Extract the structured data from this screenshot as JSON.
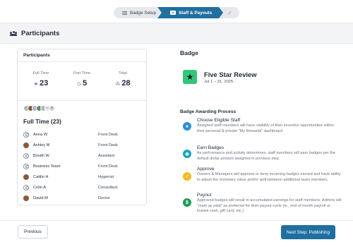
{
  "stepper": {
    "steps": [
      {
        "label": "Badge Setup",
        "state": "inactive"
      },
      {
        "label": "Staff & Payouts",
        "state": "active"
      },
      {
        "label": "✓",
        "state": "done"
      }
    ]
  },
  "header": {
    "title": "Participants"
  },
  "participants_panel": {
    "title": "Participants",
    "stats": [
      {
        "label": "Full Time",
        "value": "23"
      },
      {
        "label": "Part Time",
        "value": "5"
      },
      {
        "label": "Total",
        "value": "28"
      }
    ],
    "more_avatars": "+22",
    "group_title": "Full Time (23)",
    "staff": [
      {
        "name": "Anna W",
        "role": "Front Desk",
        "avatar": "generic"
      },
      {
        "name": "Ashley M",
        "role": "Front Desk",
        "avatar": "photo"
      },
      {
        "name": "Bosith W",
        "role": "Assistant",
        "avatar": "generic"
      },
      {
        "name": "Business Team",
        "role": "Front Desk",
        "avatar": "generic"
      },
      {
        "name": "Caitlin H",
        "role": "Hygenist",
        "avatar": "photo"
      },
      {
        "name": "Colin A",
        "role": "Consultant",
        "avatar": "generic"
      },
      {
        "name": "David M",
        "role": "Doctor",
        "avatar": "photo"
      }
    ]
  },
  "badge": {
    "heading": "Badge",
    "name": "Five Star Review",
    "dates": "Jul 1 – 31, 2025",
    "icon": "star-icon",
    "color": "#34c47c"
  },
  "process": {
    "heading": "Badge Awarding Process",
    "steps": [
      {
        "title": "Choose Eligible Staff",
        "description": "Assigned staff members will have visibility of their incentive opportunities within their personal & private \"My Rewards\" dashboard",
        "icon": "users-icon",
        "color": "#2d8fd5"
      },
      {
        "title": "Earn Badges",
        "description": "As performance and activity determines, staff members will earn badges per the default dollar amount assigned in previous step.",
        "icon": "trophy-icon",
        "color": "#17a6b8"
      },
      {
        "title": "Approve",
        "description": "Owners & Managers will approve or deny incoming badges earned and have ability to adjust the monetary value and/or split between additional team members.",
        "icon": "check-icon",
        "color": "#f5b820"
      },
      {
        "title": "Payout",
        "description": "Approved badges will result in accumulated earnings for staff members. Admins will \"mark as paid\" as preferred for their payout cycle (ie., end of month payroll or instant cash, gift card, etc.)",
        "icon": "dollar-icon",
        "color": "#1f9d55"
      }
    ]
  },
  "footer": {
    "previous_label": "Previous",
    "next_label": "Next Step: Publishing"
  }
}
